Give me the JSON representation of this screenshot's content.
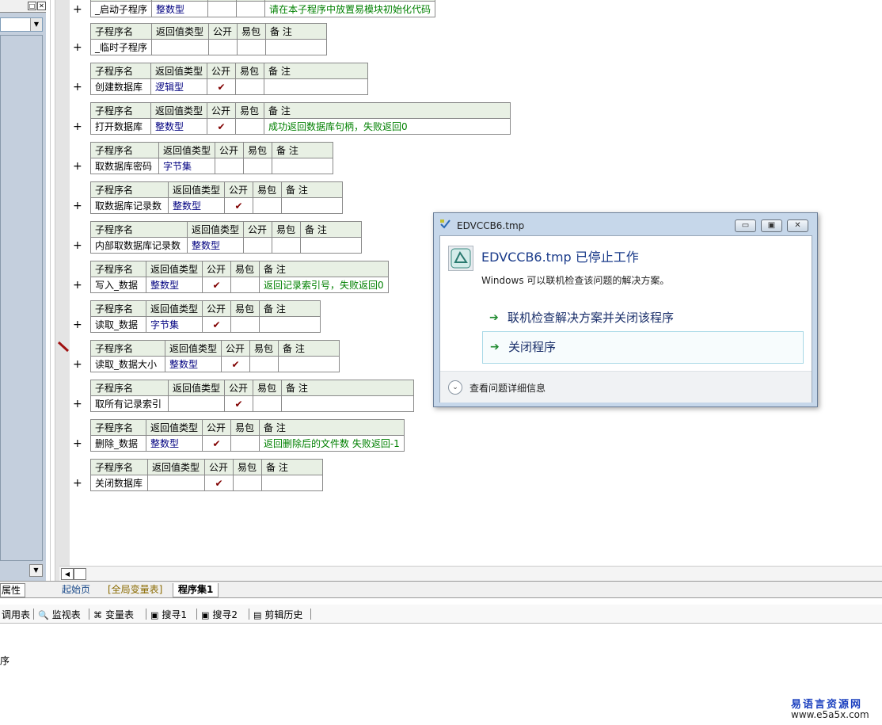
{
  "left_panel": {
    "tab_label": "属性"
  },
  "subroutines": [
    {
      "plus": "+",
      "name": "_启动子程序",
      "type": "整数型",
      "public": "",
      "easy": "",
      "note": "请在本子程序中放置易模块初始化代码",
      "header_visible": false
    },
    {
      "plus": "+",
      "name": "_临时子程序",
      "type": "",
      "public": "",
      "easy": "",
      "note": "",
      "header_visible": true
    },
    {
      "plus": "+",
      "name": "创建数据库",
      "type": "逻辑型",
      "public": "✔",
      "easy": "",
      "note": "",
      "header_visible": true
    },
    {
      "plus": "+",
      "name": "打开数据库",
      "type": "整数型",
      "public": "✔",
      "easy": "",
      "note": "成功返回数据库句柄，失败返回0",
      "header_visible": true
    },
    {
      "plus": "+",
      "name": "取数据库密码",
      "type": "字节集",
      "public": "",
      "easy": "",
      "note": "",
      "header_visible": true
    },
    {
      "plus": "+",
      "name": "取数据库记录数",
      "type": "整数型",
      "public": "✔",
      "easy": "",
      "note": "",
      "header_visible": true
    },
    {
      "plus": "+",
      "name": "内部取数据库记录数",
      "type": "整数型",
      "public": "",
      "easy": "",
      "note": "",
      "header_visible": true
    },
    {
      "plus": "+",
      "name": "写入_数据",
      "type": "整数型",
      "public": "✔",
      "easy": "",
      "note": "返回记录索引号，失败返回0",
      "header_visible": true
    },
    {
      "plus": "+",
      "name": "读取_数据",
      "type": "字节集",
      "public": "✔",
      "easy": "",
      "note": "",
      "header_visible": true
    },
    {
      "plus": "+",
      "name": "读取_数据大小",
      "type": "整数型",
      "public": "✔",
      "easy": "",
      "note": "",
      "header_visible": true
    },
    {
      "plus": "+",
      "name": "取所有记录索引",
      "type": "",
      "public": "✔",
      "easy": "",
      "note": "",
      "header_visible": true
    },
    {
      "plus": "+",
      "name": "删除_数据",
      "type": "整数型",
      "public": "✔",
      "easy": "",
      "note": "返回删除后的文件数 失败返回-1",
      "header_visible": true
    },
    {
      "plus": "+",
      "name": "关闭数据库",
      "type": "",
      "public": "✔",
      "easy": "",
      "note": "",
      "header_visible": true
    }
  ],
  "table_headers": {
    "name": "子程序名",
    "type": "返回值类型",
    "public": "公开",
    "easy": "易包",
    "note": "备 注"
  },
  "tabs": {
    "start": "起始页",
    "globals": "[全局变量表]",
    "program_set": "程序集1"
  },
  "toolbar": [
    {
      "label": "调用表",
      "icon": "call-table-icon"
    },
    {
      "label": "监视表",
      "icon": "magnifier-icon"
    },
    {
      "label": "变量表",
      "icon": "variables-icon"
    },
    {
      "label": "搜寻1",
      "icon": "search-1-icon"
    },
    {
      "label": "搜寻2",
      "icon": "search-2-icon"
    },
    {
      "label": "剪辑历史",
      "icon": "clip-history-icon"
    }
  ],
  "output_text": "序",
  "dialog": {
    "title": "EDVCCB6.tmp",
    "headline": "EDVCCB6.tmp 已停止工作",
    "subline": "Windows 可以联机检查该问题的解决方案。",
    "option1": "联机检查解决方案并关闭该程序",
    "option2": "关闭程序",
    "footer": "查看问题详细信息",
    "minimize": "▭",
    "maximize": "▣",
    "close": "✕"
  },
  "watermark": {
    "line1": "易语言资源网",
    "line2": "www.e5a5x.com"
  }
}
